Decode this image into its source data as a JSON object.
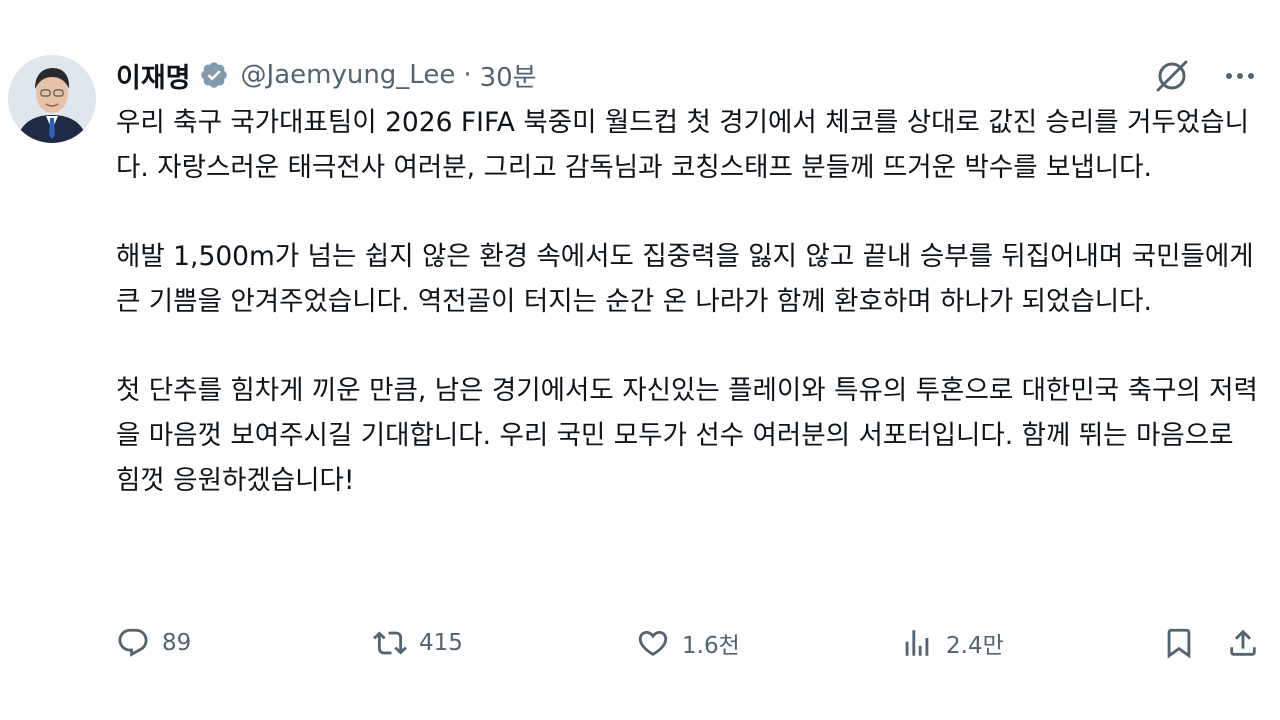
{
  "author": {
    "display_name": "이재명",
    "handle": "@Jaemyung_Lee",
    "separator": "·",
    "time": "30분",
    "verified": true,
    "verified_color": "#1d9bf0"
  },
  "icons": {
    "avatar": "profile-photo",
    "verified": "verified-badge-icon",
    "grok": "grok-icon",
    "more": "more-icon",
    "reply": "reply-icon",
    "retweet": "retweet-icon",
    "like": "heart-icon",
    "views": "views-icon",
    "bookmark": "bookmark-icon",
    "share": "share-icon"
  },
  "body": {
    "paragraphs": [
      "우리 축구 국가대표팀이 2026 FIFA 북중미 월드컵 첫 경기에서 체코를 상대로 값진 승리를 거두었습니다. 자랑스러운 태극전사 여러분, 그리고 감독님과 코칭스태프 분들께 뜨거운 박수를 보냅니다.",
      "해발 1,500m가 넘는 쉽지 않은 환경 속에서도 집중력을 잃지 않고 끝내 승부를 뒤집어내며 국민들에게 큰 기쁨을 안겨주었습니다. 역전골이 터지는 순간 온 나라가 함께 환호하며 하나가 되었습니다.",
      "첫 단추를 힘차게 끼운 만큼, 남은 경기에서도 자신있는 플레이와 특유의 투혼으로 대한민국 축구의 저력을 마음껏 보여주시길 기대합니다. 우리 국민 모두가 선수 여러분의 서포터입니다. 함께 뛰는 마음으로 힘껏 응원하겠습니다!"
    ]
  },
  "actions": {
    "reply_count": "89",
    "retweet_count": "415",
    "like_count": "1.6천",
    "view_count": "2.4만"
  },
  "colors": {
    "text": "#0f1419",
    "secondary": "#536471",
    "accent": "#1d9bf0"
  }
}
